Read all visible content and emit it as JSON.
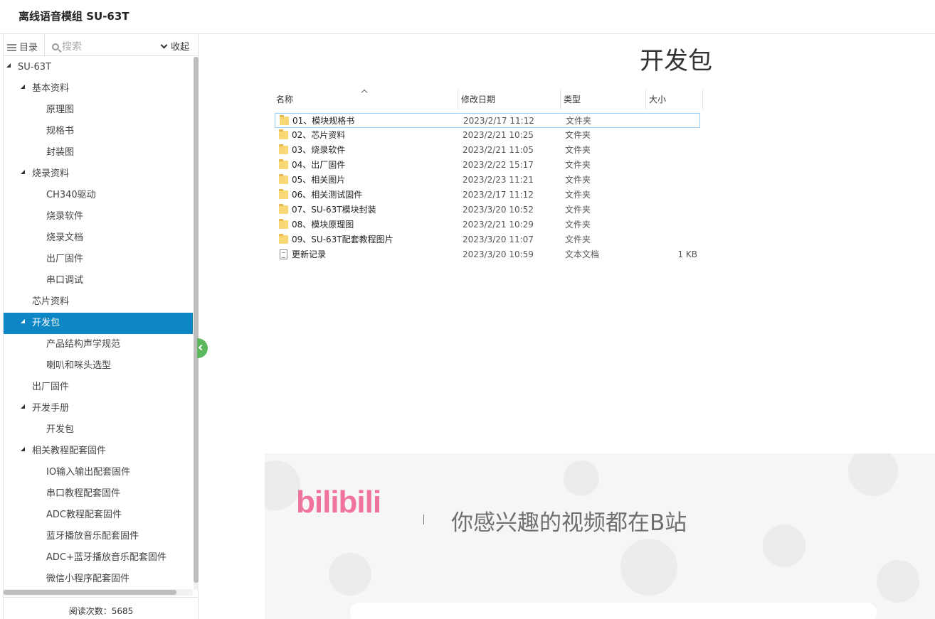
{
  "header": {
    "title": "离线语音模组 SU-63T"
  },
  "sidebar": {
    "toc_label": "目录",
    "search_placeholder": "搜索",
    "collapse_label": "收起",
    "read_count": "阅读次数：5685",
    "items": [
      {
        "label": "SU-63T",
        "level": 0,
        "expanded": true
      },
      {
        "label": "基本资料",
        "level": 1,
        "expanded": true
      },
      {
        "label": "原理图",
        "level": 2
      },
      {
        "label": "规格书",
        "level": 2
      },
      {
        "label": "封装图",
        "level": 2
      },
      {
        "label": "烧录资料",
        "level": 1,
        "expanded": true
      },
      {
        "label": "CH340驱动",
        "level": 2
      },
      {
        "label": "烧录软件",
        "level": 2
      },
      {
        "label": "烧录文档",
        "level": 2
      },
      {
        "label": "出厂固件",
        "level": 2
      },
      {
        "label": "串口调试",
        "level": 2
      },
      {
        "label": "芯片资料",
        "level": 1
      },
      {
        "label": "开发包",
        "level": 1,
        "expanded": true,
        "active": true
      },
      {
        "label": "产品结构声学规范",
        "level": 2
      },
      {
        "label": "喇叭和咪头选型",
        "level": 2
      },
      {
        "label": "出厂固件",
        "level": 1
      },
      {
        "label": "开发手册",
        "level": 1,
        "expanded": true
      },
      {
        "label": "开发包",
        "level": 2
      },
      {
        "label": "相关教程配套固件",
        "level": 1,
        "expanded": true
      },
      {
        "label": "IO输入输出配套固件",
        "level": 2
      },
      {
        "label": "串口教程配套固件",
        "level": 2
      },
      {
        "label": "ADC教程配套固件",
        "level": 2
      },
      {
        "label": "蓝牙播放音乐配套固件",
        "level": 2
      },
      {
        "label": "ADC+蓝牙播放音乐配套固件",
        "level": 2
      },
      {
        "label": "微信小程序配套固件",
        "level": 2
      }
    ]
  },
  "main": {
    "title": "开发包",
    "explorer": {
      "columns": [
        "名称",
        "修改日期",
        "类型",
        "大小"
      ],
      "rows": [
        {
          "name": "01、模块规格书",
          "date": "2023/2/17 11:12",
          "type": "文件夹",
          "size": "",
          "kind": "folder"
        },
        {
          "name": "02、芯片资料",
          "date": "2023/2/21 10:25",
          "type": "文件夹",
          "size": "",
          "kind": "folder"
        },
        {
          "name": "03、烧录软件",
          "date": "2023/2/21 11:05",
          "type": "文件夹",
          "size": "",
          "kind": "folder"
        },
        {
          "name": "04、出厂固件",
          "date": "2023/2/22 15:17",
          "type": "文件夹",
          "size": "",
          "kind": "folder"
        },
        {
          "name": "05、相关图片",
          "date": "2023/2/23 11:21",
          "type": "文件夹",
          "size": "",
          "kind": "folder"
        },
        {
          "name": "06、相关测试固件",
          "date": "2023/2/17 11:12",
          "type": "文件夹",
          "size": "",
          "kind": "folder"
        },
        {
          "name": "07、SU-63T模块封装",
          "date": "2023/3/20 10:52",
          "type": "文件夹",
          "size": "",
          "kind": "folder"
        },
        {
          "name": "08、模块原理图",
          "date": "2023/2/21 10:29",
          "type": "文件夹",
          "size": "",
          "kind": "folder"
        },
        {
          "name": "09、SU-63T配套教程图片",
          "date": "2023/3/20 11:07",
          "type": "文件夹",
          "size": "",
          "kind": "folder"
        },
        {
          "name": "更新记录",
          "date": "2023/3/20 10:59",
          "type": "文本文档",
          "size": "1 KB",
          "kind": "text"
        }
      ]
    },
    "banner": {
      "logo_text": "bilibili",
      "slogan": "你感兴趣的视频都在B站",
      "logo_color": "#f0739e"
    }
  },
  "colors": {
    "active": "#0d86c6",
    "toggle": "#5cb85c"
  }
}
